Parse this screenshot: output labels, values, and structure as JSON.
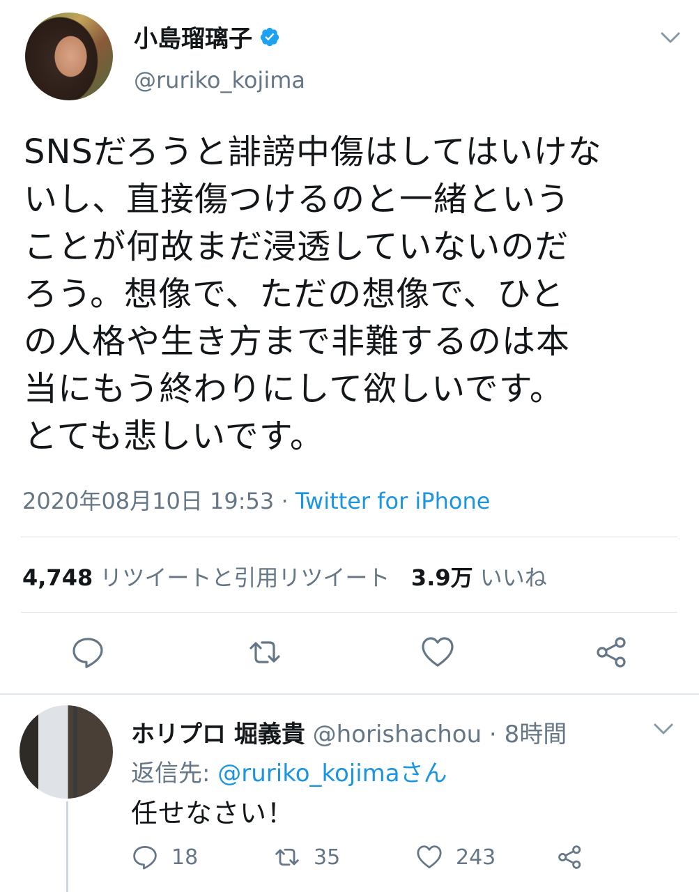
{
  "tweet": {
    "display_name": "小島瑠璃子",
    "handle": "@ruriko_kojima",
    "text": "SNSだろうと誹謗中傷はしてはいけな\nいし、直接傷つけるのと一緒という\nことが何故まだ浸透していないのだ\nろう。想像で、ただの想像で、ひと\nの人格や生き方まで非難するのは本\n当にもう終わりにして欲しいです。\nとても悲しいです。",
    "timestamp": "2020年08月10日 19:53",
    "separator": " · ",
    "source": "Twitter for iPhone",
    "retweet_count": "4,748",
    "retweet_label": "リツイートと引用リツイート",
    "like_count": "3.9万",
    "like_label": "いいね"
  },
  "reply": {
    "display_name": "ホリプロ 堀義貴",
    "handle": "@horishachou",
    "time_sep": " · ",
    "time": "8時間",
    "reply_to_prefix": "返信先: ",
    "reply_to_handle": "@ruriko_kojimaさん",
    "text": "任せなさい！",
    "reply_count": "18",
    "retweet_count": "35",
    "like_count": "243"
  },
  "colors": {
    "text": "#14171a",
    "muted": "#657786",
    "link": "#1b95e0",
    "verified": "#1da1f2",
    "divider": "#e1e8ed"
  },
  "icons": [
    "verified-badge-icon",
    "chevron-down-icon",
    "reply-icon",
    "retweet-icon",
    "like-icon",
    "share-icon"
  ]
}
